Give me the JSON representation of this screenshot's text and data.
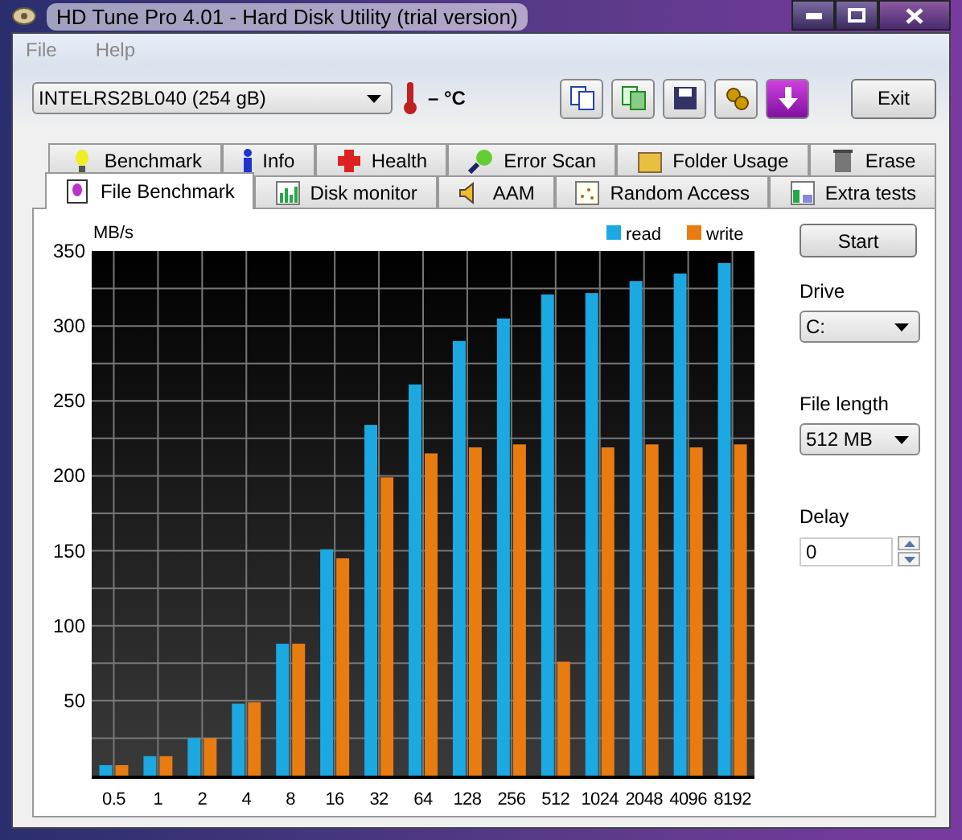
{
  "window": {
    "title": "HD Tune Pro 4.01 - Hard Disk Utility (trial version)"
  },
  "menu": [
    "File",
    "Help"
  ],
  "toolbar": {
    "drive": "INTELRS2BL040 (254 gB)",
    "temperature": "– °C",
    "exit": "Exit"
  },
  "tabs_back": [
    {
      "label": "Benchmark",
      "selected": false
    },
    {
      "label": "Info",
      "selected": false
    },
    {
      "label": "Health",
      "selected": false
    },
    {
      "label": "Error Scan",
      "selected": false
    },
    {
      "label": "Folder Usage",
      "selected": false
    },
    {
      "label": "Erase",
      "selected": false
    }
  ],
  "tabs_front": [
    {
      "label": "File Benchmark",
      "selected": true
    },
    {
      "label": "Disk monitor",
      "selected": false
    },
    {
      "label": "AAM",
      "selected": false
    },
    {
      "label": "Random Access",
      "selected": false
    },
    {
      "label": "Extra tests",
      "selected": false
    }
  ],
  "chart": {
    "chart_data": {
      "type": "bar",
      "grid": true,
      "legend": true,
      "ylabel": "MB/s",
      "categories": [
        "0.5",
        "1",
        "2",
        "4",
        "8",
        "16",
        "32",
        "64",
        "128",
        "256",
        "512",
        "1024",
        "2048",
        "4096",
        "8192"
      ],
      "ylim": [
        0,
        350
      ],
      "yticks": [
        50,
        100,
        150,
        200,
        250,
        300,
        350
      ],
      "series": [
        {
          "name": "read",
          "color": "#1ca8e0",
          "values": [
            7,
            13,
            25,
            48,
            88,
            151,
            234,
            261,
            290,
            305,
            321,
            322,
            330,
            335,
            342
          ]
        },
        {
          "name": "write",
          "color": "#e87c10",
          "values": [
            7,
            13,
            25,
            49,
            88,
            145,
            199,
            215,
            219,
            221,
            76,
            219,
            221,
            219,
            221
          ]
        }
      ]
    }
  },
  "side": {
    "start": "Start",
    "drive_label": "Drive",
    "drive": "C:",
    "length_label": "File length",
    "length": "512 MB",
    "delay_label": "Delay",
    "delay": "0"
  }
}
